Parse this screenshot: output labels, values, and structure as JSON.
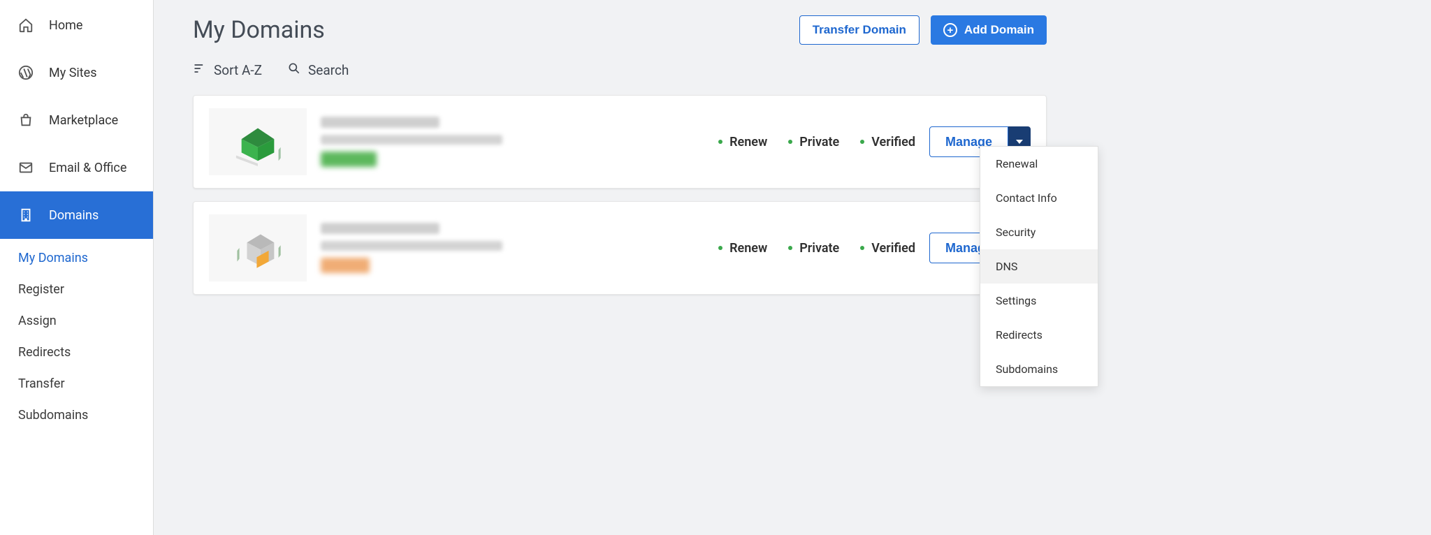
{
  "sidebar": {
    "items": [
      {
        "label": "Home"
      },
      {
        "label": "My Sites"
      },
      {
        "label": "Marketplace"
      },
      {
        "label": "Email & Office"
      },
      {
        "label": "Domains"
      }
    ],
    "sub": [
      "My Domains",
      "Register",
      "Assign",
      "Redirects",
      "Transfer",
      "Subdomains"
    ]
  },
  "header": {
    "title": "My Domains",
    "transfer": "Transfer Domain",
    "add": "Add Domain"
  },
  "toolbar": {
    "sort": "Sort A-Z",
    "search": "Search"
  },
  "statuses": {
    "renew": "Renew",
    "private": "Private",
    "verified": "Verified"
  },
  "manage": "Manage",
  "dropdown": [
    "Renewal",
    "Contact Info",
    "Security",
    "DNS",
    "Settings",
    "Redirects",
    "Subdomains"
  ]
}
